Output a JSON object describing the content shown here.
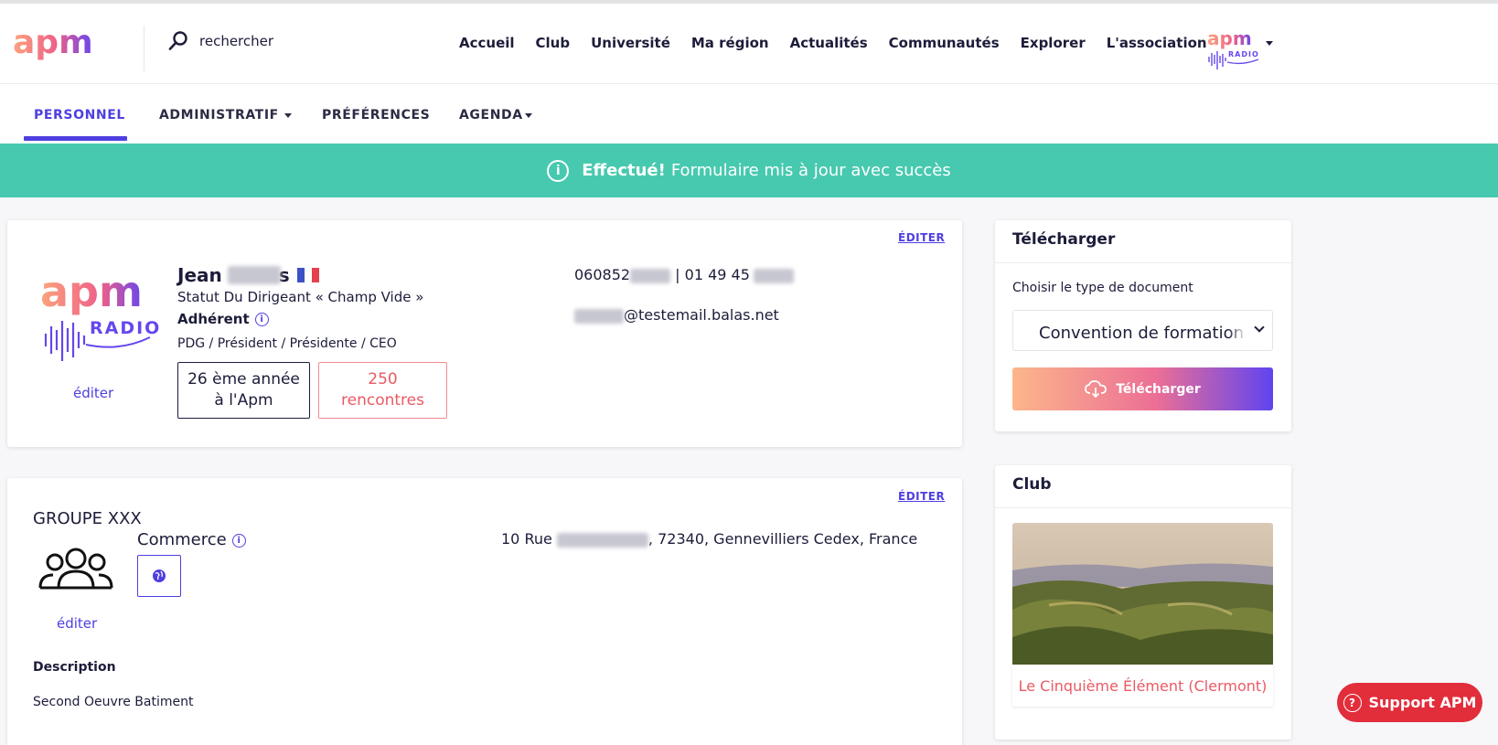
{
  "brand": {
    "logo": "apm",
    "radio_logo": "apm",
    "radio_label": "RADIO"
  },
  "search": {
    "placeholder": "rechercher"
  },
  "main_nav": [
    "Accueil",
    "Club",
    "Université",
    "Ma région",
    "Actualités",
    "Communautés",
    "Explorer",
    "L'association"
  ],
  "sub_nav": {
    "personnel": "PERSONNEL",
    "administratif": "ADMINISTRATIF",
    "preferences": "PRÉFÉRENCES",
    "agenda": "AGENDA"
  },
  "banner": {
    "strong": "Effectué!",
    "message": "Formulaire mis à jour avec succès"
  },
  "profile": {
    "edit_label": "ÉDITER",
    "first_name": "Jean",
    "last_name_tail": "s",
    "status": "Statut Du Dirigeant « Champ Vide »",
    "member": "Adhérent",
    "role": "PDG / Président / Présidente / CEO",
    "years_line1": "26 ème année",
    "years_line2": "à l'Apm",
    "meetings_count": "250",
    "meetings_label": "rencontres",
    "photo_edit": "éditer",
    "phone_prefix": "060852",
    "phone_separator": "|",
    "phone_mid": "01 49 45",
    "email_domain": "@testemail.balas.net"
  },
  "company": {
    "edit_label": "ÉDITER",
    "name": "GROUPE XXX",
    "sector": "Commerce",
    "logo_edit": "éditer",
    "address_prefix": "10 Rue",
    "address_suffix": ", 72340, Gennevilliers Cedex, France",
    "description_label": "Description",
    "description": "Second Oeuvre Batiment"
  },
  "download": {
    "title": "Télécharger",
    "field_label": "Choisir le type de document",
    "selected": "Convention de formation",
    "button": "Télécharger"
  },
  "club": {
    "title": "Club",
    "name": "Le Cinquième Élément (Clermont)"
  },
  "support": {
    "label": "Support APM"
  },
  "colors": {
    "accent": "#4e3fe0",
    "success": "#47c9af",
    "danger": "#e22d3b",
    "coral": "#ea5a64"
  },
  "icons": [
    "search-icon",
    "info-icon",
    "cloud-download-icon",
    "globe-icon",
    "group-icon",
    "help-icon",
    "caret-down-icon",
    "chevron-down-icon"
  ]
}
